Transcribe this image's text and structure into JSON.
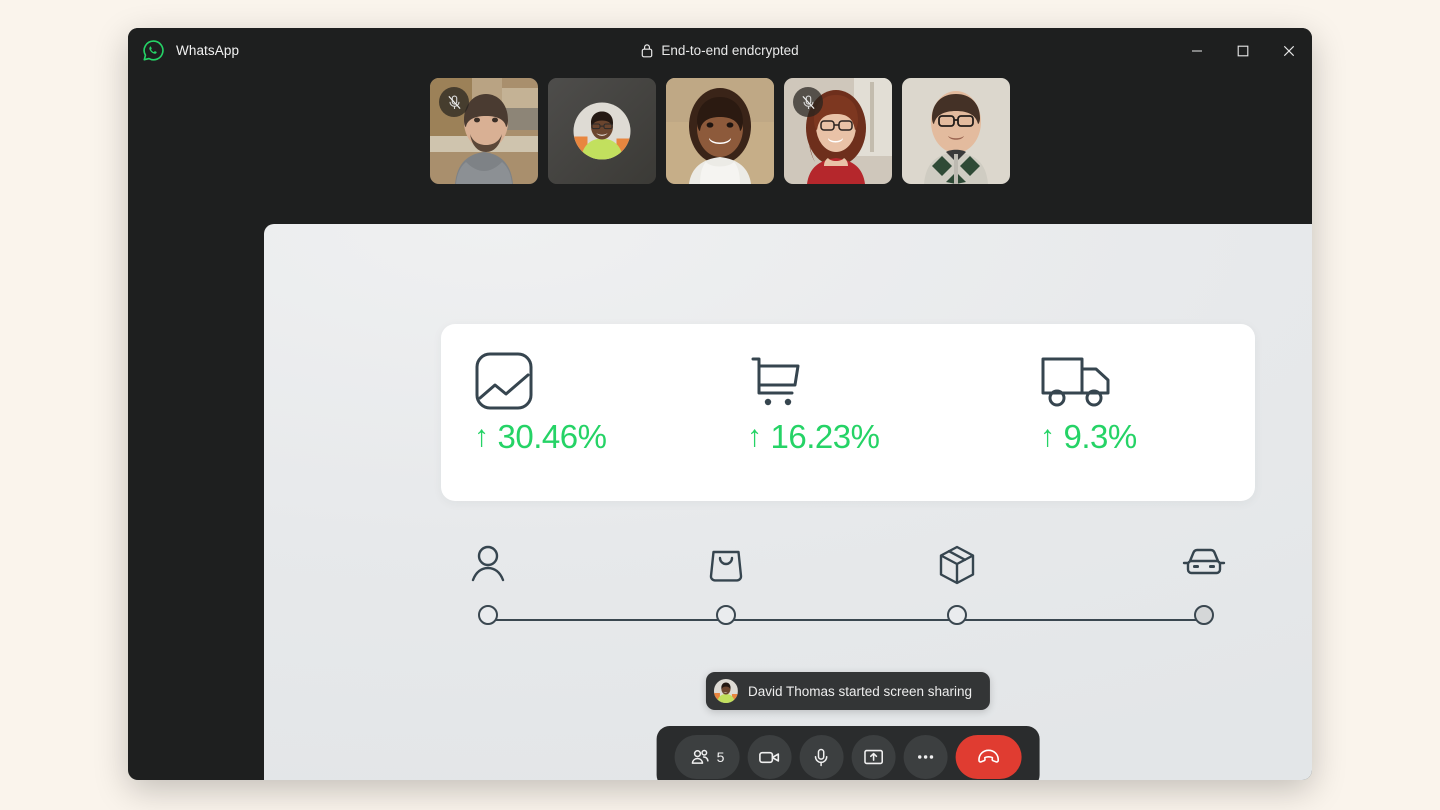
{
  "page": {
    "background_color": "#FAF4EC"
  },
  "window": {
    "app_name": "WhatsApp",
    "logo_icon": "whatsapp-logo-icon",
    "encryption_label": "End-to-end endcrypted",
    "encryption_icon": "lock-icon",
    "controls": [
      {
        "name": "minimize",
        "icon": "minimize-icon"
      },
      {
        "name": "maximize",
        "icon": "maximize-icon"
      },
      {
        "name": "close",
        "icon": "close-icon"
      }
    ]
  },
  "participants": {
    "count": 5,
    "tiles": [
      {
        "name": "participant-1",
        "muted": true,
        "mode": "video",
        "skin": "#c9a889",
        "bg": "#8a7a63"
      },
      {
        "name": "participant-2",
        "muted": false,
        "mode": "avatar",
        "skin": "#6b4a33",
        "bg": "#4c4a45"
      },
      {
        "name": "participant-3",
        "muted": false,
        "mode": "video",
        "skin": "#8b5e3c",
        "bg": "#b49b76"
      },
      {
        "name": "participant-4",
        "muted": true,
        "mode": "video",
        "skin": "#e4bda2",
        "bg": "#cdbdb0"
      },
      {
        "name": "participant-5",
        "muted": false,
        "mode": "video",
        "skin": "#dbb79c",
        "bg": "#d9d4cb"
      }
    ],
    "mute_icon": "mic-off-icon"
  },
  "shared_screen": {
    "metrics": [
      {
        "icon": "image-chart-icon",
        "arrow": "↑",
        "value": "30.46%"
      },
      {
        "icon": "shopping-cart-icon",
        "arrow": "↑",
        "value": "16.23%"
      },
      {
        "icon": "delivery-truck-icon",
        "arrow": "↑",
        "value": "9.3%"
      }
    ],
    "accent_color": "#25D366",
    "icon_color": "#36454F",
    "timeline": {
      "steps": [
        {
          "icon": "person-icon",
          "label_icon": "person-icon",
          "position_pct": 0,
          "filled": false
        },
        {
          "icon": "shopping-bag-icon",
          "label_icon": "shopping-bag-icon",
          "position_pct": 33.2,
          "filled": false
        },
        {
          "icon": "package-box-icon",
          "label_icon": "package-box-icon",
          "position_pct": 65.5,
          "filled": false
        },
        {
          "icon": "car-front-icon",
          "label_icon": "car-front-icon",
          "position_pct": 100,
          "filled": true
        }
      ]
    }
  },
  "toast": {
    "avatar_icon": "user-avatar",
    "message": "David Thomas started screen sharing"
  },
  "control_bar": {
    "buttons": [
      {
        "name": "participants-button",
        "icon": "people-icon",
        "label": "5"
      },
      {
        "name": "camera-button",
        "icon": "video-camera-icon",
        "label": ""
      },
      {
        "name": "microphone-button",
        "icon": "microphone-icon",
        "label": ""
      },
      {
        "name": "share-screen-button",
        "icon": "share-screen-icon",
        "label": ""
      },
      {
        "name": "more-options-button",
        "icon": "more-dots-icon",
        "label": ""
      },
      {
        "name": "end-call-button",
        "icon": "end-call-icon",
        "label": "",
        "color": "#E03C31"
      }
    ]
  }
}
